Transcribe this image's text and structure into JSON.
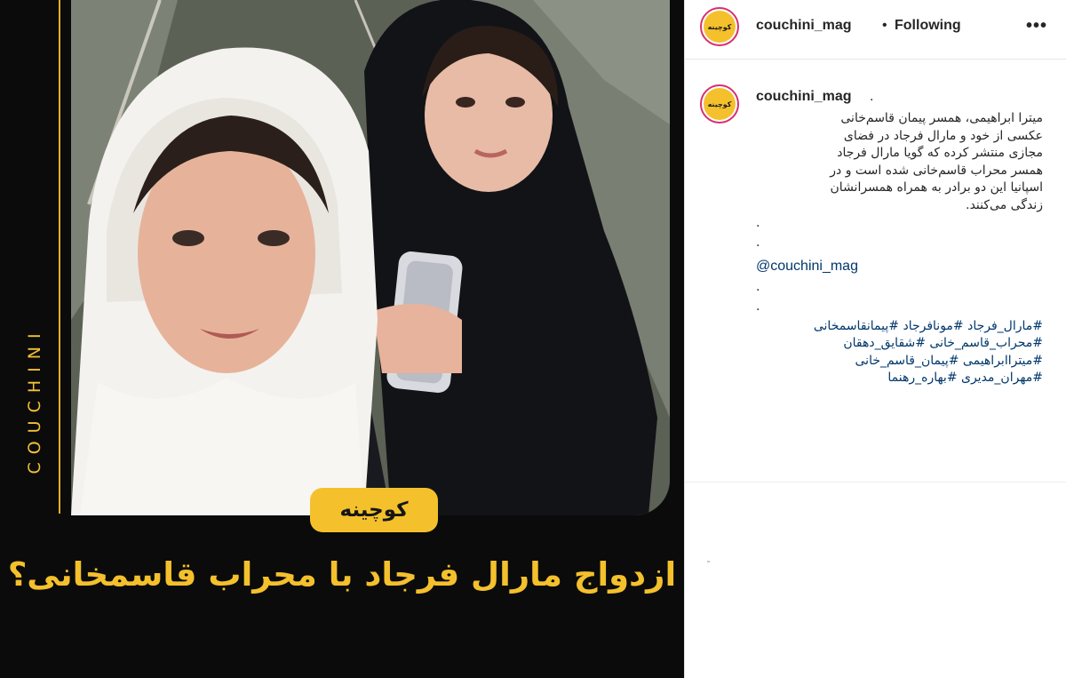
{
  "post": {
    "side_label": "COUCHINI",
    "logo_text": "کوچینه",
    "headline": "ازدواج مارال فرجاد با محراب قاسمخانی؟"
  },
  "header": {
    "username": "couchini_mag",
    "separator": "•",
    "follow_status": "Following",
    "more_icon": "more-icon"
  },
  "caption": {
    "username": "couchini_mag",
    "username_suffix": ".",
    "lines": [
      "میترا ابراهیمی، همسر پیمان قاسم‌خانی",
      "عکسی از خود و مارال فرجاد در فضای",
      "مجازی منتشر کرده که گویا مارال فرجاد",
      "همسر محراب قاسم‌خانی شده است و در",
      "اسپانیا این دو برادر به همراه همسرانشان",
      "زندگی می‌کنند."
    ],
    "dot1": ".",
    "dot2": ".",
    "mention": "@couchini_mag",
    "dot3": ".",
    "dot4": ".",
    "hashtags": [
      "#مارال_فرجاد #مونافرجاد #پیمانقاسمخانی",
      "#محراب_قاسم_خانی #شقایق_دهقان",
      "#میتراابراهیمی #پیمان_قاسم_خانی",
      "#مهران_مدیری #بهاره_رهنما"
    ]
  },
  "colors": {
    "brand_yellow": "#f4c02c",
    "link_blue": "#00376b",
    "dark_bg": "#0b0b0c"
  }
}
